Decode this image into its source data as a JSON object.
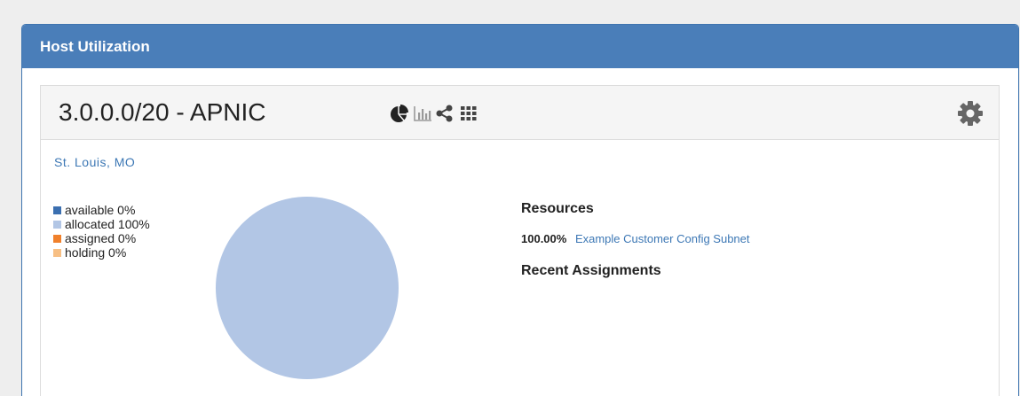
{
  "panel": {
    "title": "Host Utilization"
  },
  "block": {
    "title": "3.0.0.0/20 - APNIC",
    "toolbar_icons": [
      "pie-chart-icon",
      "bar-chart-icon",
      "share-icon",
      "grid-icon"
    ],
    "settings_icon": "gear-icon",
    "location": "St. Louis, MO"
  },
  "legend": [
    {
      "label": "available 0%",
      "color": "#3b6fb0"
    },
    {
      "label": "allocated 100%",
      "color": "#b2c6e5"
    },
    {
      "label": "assigned 0%",
      "color": "#f0802b"
    },
    {
      "label": "holding 0%",
      "color": "#f7bf84"
    }
  ],
  "pie": {
    "slices": [
      {
        "name": "available",
        "percent": 0,
        "color": "#3b6fb0"
      },
      {
        "name": "allocated",
        "percent": 100,
        "color": "#b2c6e5"
      },
      {
        "name": "assigned",
        "percent": 0,
        "color": "#f0802b"
      },
      {
        "name": "holding",
        "percent": 0,
        "color": "#f7bf84"
      }
    ]
  },
  "resources": {
    "title": "Resources",
    "items": [
      {
        "percent": "100.00%",
        "name": "Example Customer Config Subnet"
      }
    ]
  },
  "recent": {
    "title": "Recent Assignments"
  },
  "colors": {
    "header_bg": "#4a7eb9",
    "link": "#3d78b5"
  }
}
